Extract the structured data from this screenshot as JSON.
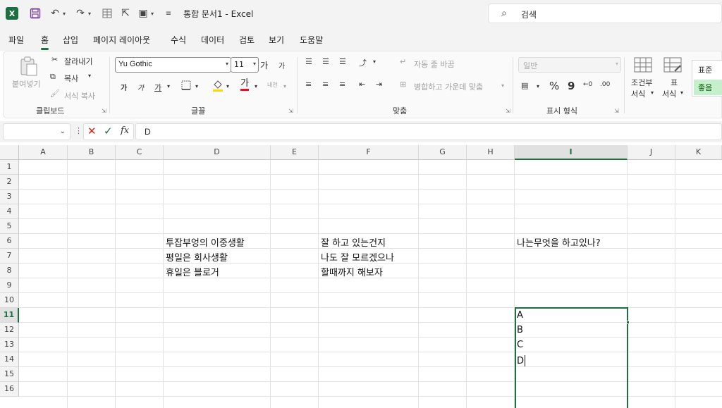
{
  "titlebar": {
    "app_icon": "excel-logo-icon",
    "app_letter": "X",
    "doc_title": "통합 문서1  -  Excel",
    "search_label": "검색"
  },
  "tabs": [
    "파일",
    "홈",
    "삽입",
    "페이지 레이아웃",
    "수식",
    "데이터",
    "검토",
    "보기",
    "도움말"
  ],
  "active_tab": "홈",
  "ribbon": {
    "clipboard": {
      "paste": "붙여넣기",
      "cut": "잘라내기",
      "copy": "복사",
      "format_painter": "서식 복사",
      "label": "클립보드"
    },
    "font": {
      "family": "Yu Gothic",
      "size": "11",
      "grow": "가",
      "shrink": "가",
      "bold": "가",
      "italic": "가",
      "underline": "가",
      "font_color": "가",
      "phonetic": "내천",
      "label": "글꼴",
      "font_color_hex": "#e81123",
      "fill_color_hex": "#ffd800"
    },
    "alignment": {
      "wrap": "자동 줄 바꿈",
      "merge": "병합하고 가운데 맞춤",
      "label": "맞춤"
    },
    "number": {
      "format": "일반",
      "percent": "%",
      "comma": "9",
      "label": "표시 형식"
    },
    "styles": {
      "conditional_1": "조건부",
      "conditional_2": "서식",
      "table_1": "표",
      "table_2": "서식",
      "normal": "표준",
      "good": "좋음"
    }
  },
  "formula_bar": {
    "name_box": "",
    "content": "D"
  },
  "columns": [
    "A",
    "B",
    "C",
    "D",
    "E",
    "F",
    "G",
    "H",
    "I",
    "J",
    "K"
  ],
  "selected_column": "I",
  "rows": [
    "1",
    "2",
    "3",
    "4",
    "5",
    "6",
    "7",
    "8",
    "9",
    "10",
    "11",
    "12",
    "13",
    "14",
    "15",
    "16"
  ],
  "selected_row": "11",
  "cells": {
    "D6": "투잡부엉의 이중생활",
    "D7": "평일은 회사생활",
    "D8": "휴일은 블로거",
    "F6": "잘 하고 있는건지",
    "F7": "나도 잘 모르겠으나",
    "F8": "할때까지 해보자",
    "I6": "나는무엇을 하고있나?",
    "I11": "A",
    "I12": "B",
    "I13": "C",
    "I14": "D"
  },
  "colors": {
    "accent": "#1d6f42",
    "chrome": "#f3f3f3",
    "gridline": "#e3e3e3"
  }
}
